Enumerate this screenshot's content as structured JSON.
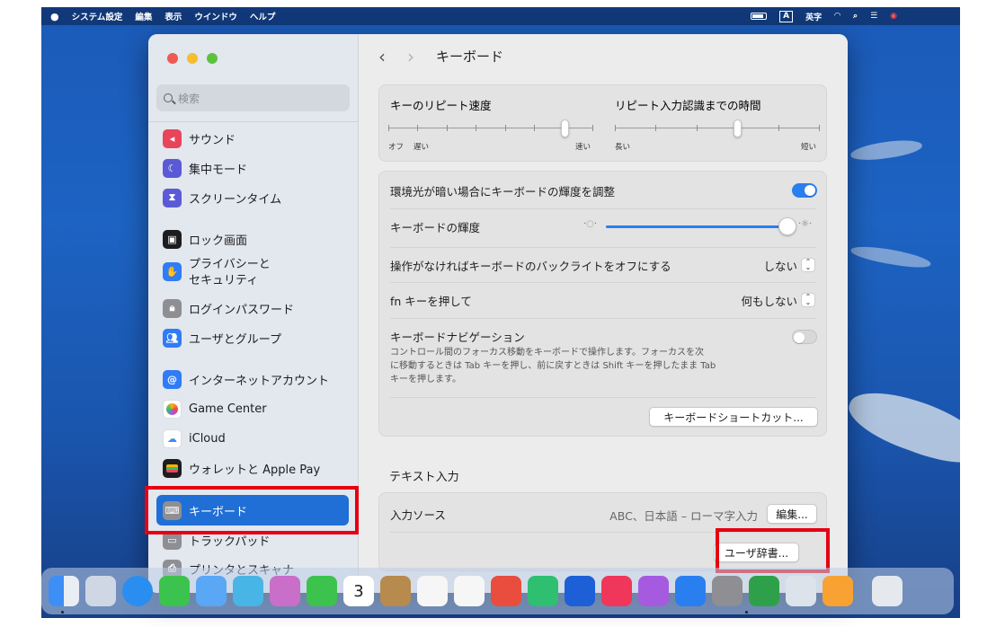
{
  "menubar": {
    "apple": "",
    "items": [
      "システム設定",
      "編集",
      "表示",
      "ウインドウ",
      "ヘルプ"
    ],
    "ime": "A",
    "ime_label": "英字"
  },
  "sidebar": {
    "search_placeholder": "検索",
    "items": [
      {
        "label": "サウンド",
        "icon": "speaker-icon",
        "color": "#e8455a"
      },
      {
        "label": "集中モード",
        "icon": "moon-icon",
        "color": "#5a5ad6"
      },
      {
        "label": "スクリーンタイム",
        "icon": "hourglass-icon",
        "color": "#5a5ad6"
      },
      {
        "label": "ロック画面",
        "icon": "lock-screen-icon",
        "color": "#1d1d1f"
      },
      {
        "label": "プライバシーと",
        "label2": "セキュリティ",
        "icon": "hand-icon",
        "color": "#2f7cf6"
      },
      {
        "label": "ログインパスワード",
        "icon": "lock-icon",
        "color": "#8e8e93"
      },
      {
        "label": "ユーザとグループ",
        "icon": "users-icon",
        "color": "#2f7cf6"
      },
      {
        "label": "インターネットアカウント",
        "icon": "at-icon",
        "color": "#2f7cf6"
      },
      {
        "label": "Game Center",
        "icon": "game-center-icon",
        "color": "#ffffff"
      },
      {
        "label": "iCloud",
        "icon": "cloud-icon",
        "color": "#ffffff"
      },
      {
        "label": "ウォレットと Apple Pay",
        "icon": "wallet-icon",
        "color": "#1d1d1f"
      },
      {
        "label": "キーボード",
        "icon": "keyboard-icon",
        "color": "#8e8e93"
      },
      {
        "label": "トラックパッド",
        "icon": "trackpad-icon",
        "color": "#8e8e93"
      },
      {
        "label": "プリンタとスキャナ",
        "icon": "printer-icon",
        "color": "#8e8e93"
      }
    ]
  },
  "content": {
    "title": "キーボード",
    "repeat": {
      "speed_label": "キーのリピート速度",
      "speed_min": "オフ",
      "speed_slow": "遅い",
      "speed_fast": "速い",
      "speed_value": 0.86,
      "delay_label": "リピート入力認識までの時間",
      "delay_long": "長い",
      "delay_short": "短い",
      "delay_value": 0.6
    },
    "backlight": {
      "auto_label": "環境光が暗い場合にキーボードの輝度を調整",
      "auto_on": true,
      "brightness_label": "キーボードの輝度",
      "brightness_value": 0.96,
      "off_label": "操作がなければキーボードのバックライトをオフにする",
      "off_value": "しない",
      "fn_label": "fn キーを押して",
      "fn_value": "何もしない"
    },
    "navigation": {
      "label": "キーボードナビゲーション",
      "desc1": "コントロール間のフォーカス移動をキーボードで操作します。フォーカスを次",
      "desc2": "に移動するときは Tab キーを押し、前に戻すときは Shift キーを押したまま Tab",
      "desc3": "キーを押します。",
      "enabled": false,
      "shortcut_button": "キーボードショートカット..."
    },
    "text_input": {
      "section": "テキスト入力",
      "source_label": "入力ソース",
      "source_value": "ABC、日本語 – ローマ字入力",
      "edit_button": "編集...",
      "dict_button": "ユーザ辞書..."
    }
  },
  "colors": {
    "accent": "#1f6fd6",
    "highlight": "#e50012",
    "toggle_on": "#2a7ff0"
  },
  "dock_status": "3"
}
